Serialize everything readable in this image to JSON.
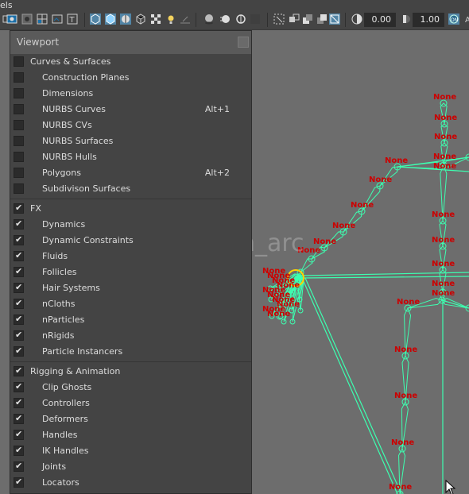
{
  "toolbar": {
    "partial_label": "els",
    "field1_value": "0.00",
    "field2_value": "1.00"
  },
  "panel": {
    "title": "Viewport",
    "groups": [
      {
        "label": "Curves & Surfaces",
        "checked": false,
        "items": [
          {
            "label": "Construction Planes",
            "shortcut": "",
            "checked": false
          },
          {
            "label": "Dimensions",
            "shortcut": "",
            "checked": false
          },
          {
            "label": "NURBS Curves",
            "shortcut": "Alt+1",
            "checked": false
          },
          {
            "label": "NURBS CVs",
            "shortcut": "",
            "checked": false
          },
          {
            "label": "NURBS Surfaces",
            "shortcut": "",
            "checked": false
          },
          {
            "label": "NURBS Hulls",
            "shortcut": "",
            "checked": false
          },
          {
            "label": "Polygons",
            "shortcut": "Alt+2",
            "checked": false
          },
          {
            "label": "Subdivison Surfaces",
            "shortcut": "",
            "checked": false
          }
        ]
      },
      {
        "label": "FX",
        "checked": true,
        "items": [
          {
            "label": "Dynamics",
            "shortcut": "",
            "checked": true
          },
          {
            "label": "Dynamic Constraints",
            "shortcut": "",
            "checked": true
          },
          {
            "label": "Fluids",
            "shortcut": "",
            "checked": true
          },
          {
            "label": "Follicles",
            "shortcut": "",
            "checked": true
          },
          {
            "label": "Hair Systems",
            "shortcut": "",
            "checked": true
          },
          {
            "label": "nCloths",
            "shortcut": "",
            "checked": true
          },
          {
            "label": "nParticles",
            "shortcut": "",
            "checked": true
          },
          {
            "label": "nRigids",
            "shortcut": "",
            "checked": true
          },
          {
            "label": "Particle Instancers",
            "shortcut": "",
            "checked": true
          }
        ]
      },
      {
        "label": "Rigging & Animation",
        "checked": true,
        "items": [
          {
            "label": "Clip Ghosts",
            "shortcut": "",
            "checked": true
          },
          {
            "label": "Controllers",
            "shortcut": "",
            "checked": true
          },
          {
            "label": "Deformers",
            "shortcut": "",
            "checked": true
          },
          {
            "label": "Handles",
            "shortcut": "",
            "checked": true
          },
          {
            "label": "IK Handles",
            "shortcut": "",
            "checked": true
          },
          {
            "label": "Joints",
            "shortcut": "",
            "checked": true
          },
          {
            "label": "Locators",
            "shortcut": "",
            "checked": true
          }
        ]
      }
    ]
  },
  "viewport": {
    "watermark": "@dawn_arc",
    "joint_label": "None",
    "colors": {
      "bone": "#3dffb0",
      "joint_label": "#cc0000",
      "selected": "#ffd200"
    }
  },
  "icons": [
    "select-mode-icon",
    "wireframe-icon",
    "smooth-shade-icon",
    "textured-icon",
    "lights-icon",
    "shadows-icon",
    "isolate-icon",
    "xray-icon",
    "camera-gate-icon",
    "exposure-icon",
    "gamma-icon",
    "color-management-icon"
  ]
}
